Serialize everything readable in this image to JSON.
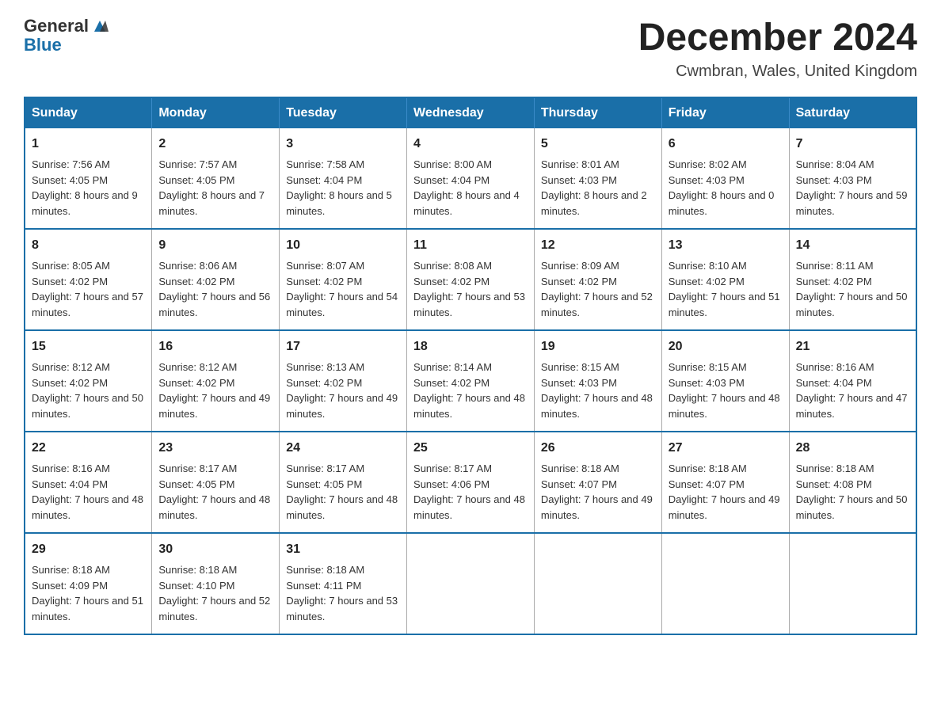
{
  "header": {
    "logo_general": "General",
    "logo_blue": "Blue",
    "month_title": "December 2024",
    "location": "Cwmbran, Wales, United Kingdom"
  },
  "days_of_week": [
    "Sunday",
    "Monday",
    "Tuesday",
    "Wednesday",
    "Thursday",
    "Friday",
    "Saturday"
  ],
  "weeks": [
    [
      {
        "day": "1",
        "sunrise": "7:56 AM",
        "sunset": "4:05 PM",
        "daylight": "8 hours and 9 minutes."
      },
      {
        "day": "2",
        "sunrise": "7:57 AM",
        "sunset": "4:05 PM",
        "daylight": "8 hours and 7 minutes."
      },
      {
        "day": "3",
        "sunrise": "7:58 AM",
        "sunset": "4:04 PM",
        "daylight": "8 hours and 5 minutes."
      },
      {
        "day": "4",
        "sunrise": "8:00 AM",
        "sunset": "4:04 PM",
        "daylight": "8 hours and 4 minutes."
      },
      {
        "day": "5",
        "sunrise": "8:01 AM",
        "sunset": "4:03 PM",
        "daylight": "8 hours and 2 minutes."
      },
      {
        "day": "6",
        "sunrise": "8:02 AM",
        "sunset": "4:03 PM",
        "daylight": "8 hours and 0 minutes."
      },
      {
        "day": "7",
        "sunrise": "8:04 AM",
        "sunset": "4:03 PM",
        "daylight": "7 hours and 59 minutes."
      }
    ],
    [
      {
        "day": "8",
        "sunrise": "8:05 AM",
        "sunset": "4:02 PM",
        "daylight": "7 hours and 57 minutes."
      },
      {
        "day": "9",
        "sunrise": "8:06 AM",
        "sunset": "4:02 PM",
        "daylight": "7 hours and 56 minutes."
      },
      {
        "day": "10",
        "sunrise": "8:07 AM",
        "sunset": "4:02 PM",
        "daylight": "7 hours and 54 minutes."
      },
      {
        "day": "11",
        "sunrise": "8:08 AM",
        "sunset": "4:02 PM",
        "daylight": "7 hours and 53 minutes."
      },
      {
        "day": "12",
        "sunrise": "8:09 AM",
        "sunset": "4:02 PM",
        "daylight": "7 hours and 52 minutes."
      },
      {
        "day": "13",
        "sunrise": "8:10 AM",
        "sunset": "4:02 PM",
        "daylight": "7 hours and 51 minutes."
      },
      {
        "day": "14",
        "sunrise": "8:11 AM",
        "sunset": "4:02 PM",
        "daylight": "7 hours and 50 minutes."
      }
    ],
    [
      {
        "day": "15",
        "sunrise": "8:12 AM",
        "sunset": "4:02 PM",
        "daylight": "7 hours and 50 minutes."
      },
      {
        "day": "16",
        "sunrise": "8:12 AM",
        "sunset": "4:02 PM",
        "daylight": "7 hours and 49 minutes."
      },
      {
        "day": "17",
        "sunrise": "8:13 AM",
        "sunset": "4:02 PM",
        "daylight": "7 hours and 49 minutes."
      },
      {
        "day": "18",
        "sunrise": "8:14 AM",
        "sunset": "4:02 PM",
        "daylight": "7 hours and 48 minutes."
      },
      {
        "day": "19",
        "sunrise": "8:15 AM",
        "sunset": "4:03 PM",
        "daylight": "7 hours and 48 minutes."
      },
      {
        "day": "20",
        "sunrise": "8:15 AM",
        "sunset": "4:03 PM",
        "daylight": "7 hours and 48 minutes."
      },
      {
        "day": "21",
        "sunrise": "8:16 AM",
        "sunset": "4:04 PM",
        "daylight": "7 hours and 47 minutes."
      }
    ],
    [
      {
        "day": "22",
        "sunrise": "8:16 AM",
        "sunset": "4:04 PM",
        "daylight": "7 hours and 48 minutes."
      },
      {
        "day": "23",
        "sunrise": "8:17 AM",
        "sunset": "4:05 PM",
        "daylight": "7 hours and 48 minutes."
      },
      {
        "day": "24",
        "sunrise": "8:17 AM",
        "sunset": "4:05 PM",
        "daylight": "7 hours and 48 minutes."
      },
      {
        "day": "25",
        "sunrise": "8:17 AM",
        "sunset": "4:06 PM",
        "daylight": "7 hours and 48 minutes."
      },
      {
        "day": "26",
        "sunrise": "8:18 AM",
        "sunset": "4:07 PM",
        "daylight": "7 hours and 49 minutes."
      },
      {
        "day": "27",
        "sunrise": "8:18 AM",
        "sunset": "4:07 PM",
        "daylight": "7 hours and 49 minutes."
      },
      {
        "day": "28",
        "sunrise": "8:18 AM",
        "sunset": "4:08 PM",
        "daylight": "7 hours and 50 minutes."
      }
    ],
    [
      {
        "day": "29",
        "sunrise": "8:18 AM",
        "sunset": "4:09 PM",
        "daylight": "7 hours and 51 minutes."
      },
      {
        "day": "30",
        "sunrise": "8:18 AM",
        "sunset": "4:10 PM",
        "daylight": "7 hours and 52 minutes."
      },
      {
        "day": "31",
        "sunrise": "8:18 AM",
        "sunset": "4:11 PM",
        "daylight": "7 hours and 53 minutes."
      },
      null,
      null,
      null,
      null
    ]
  ],
  "labels": {
    "sunrise": "Sunrise:",
    "sunset": "Sunset:",
    "daylight": "Daylight:"
  }
}
